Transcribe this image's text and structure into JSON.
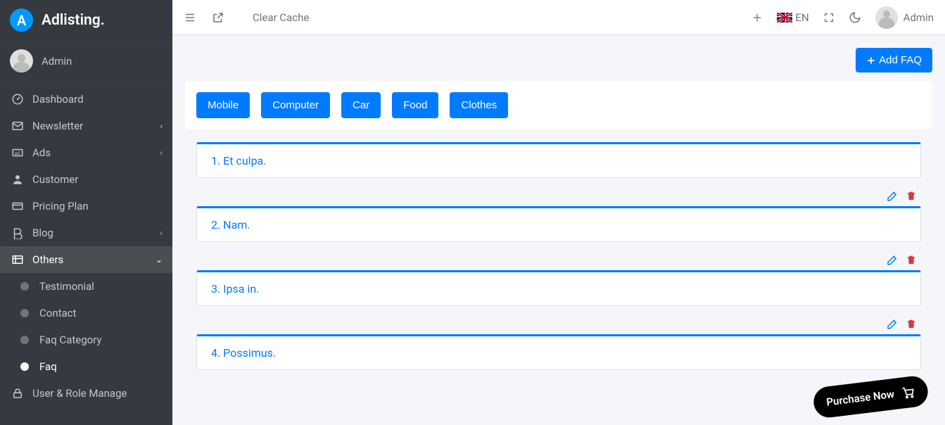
{
  "brand": {
    "logo_letter": "A",
    "name": "Adlisting."
  },
  "user": {
    "name": "Admin"
  },
  "topbar": {
    "clear_cache": "Clear Cache",
    "lang_code": "EN",
    "user_label": "Admin"
  },
  "sidebar": {
    "items": [
      {
        "label": "Dashboard"
      },
      {
        "label": "Newsletter"
      },
      {
        "label": "Ads"
      },
      {
        "label": "Customer"
      },
      {
        "label": "Pricing Plan"
      },
      {
        "label": "Blog"
      },
      {
        "label": "Others"
      },
      {
        "label": "User & Role Manage"
      }
    ],
    "others_sub": [
      {
        "label": "Testimonial"
      },
      {
        "label": "Contact"
      },
      {
        "label": "Faq Category"
      },
      {
        "label": "Faq"
      }
    ]
  },
  "actions": {
    "add_faq": "Add FAQ"
  },
  "tabs": [
    {
      "label": "Mobile"
    },
    {
      "label": "Computer"
    },
    {
      "label": "Car"
    },
    {
      "label": "Food"
    },
    {
      "label": "Clothes"
    }
  ],
  "faqs": [
    {
      "text": "1. Et culpa."
    },
    {
      "text": "2. Nam."
    },
    {
      "text": "3. Ipsa in."
    },
    {
      "text": "4. Possimus."
    }
  ],
  "purchase": {
    "label": "Purchase Now"
  }
}
